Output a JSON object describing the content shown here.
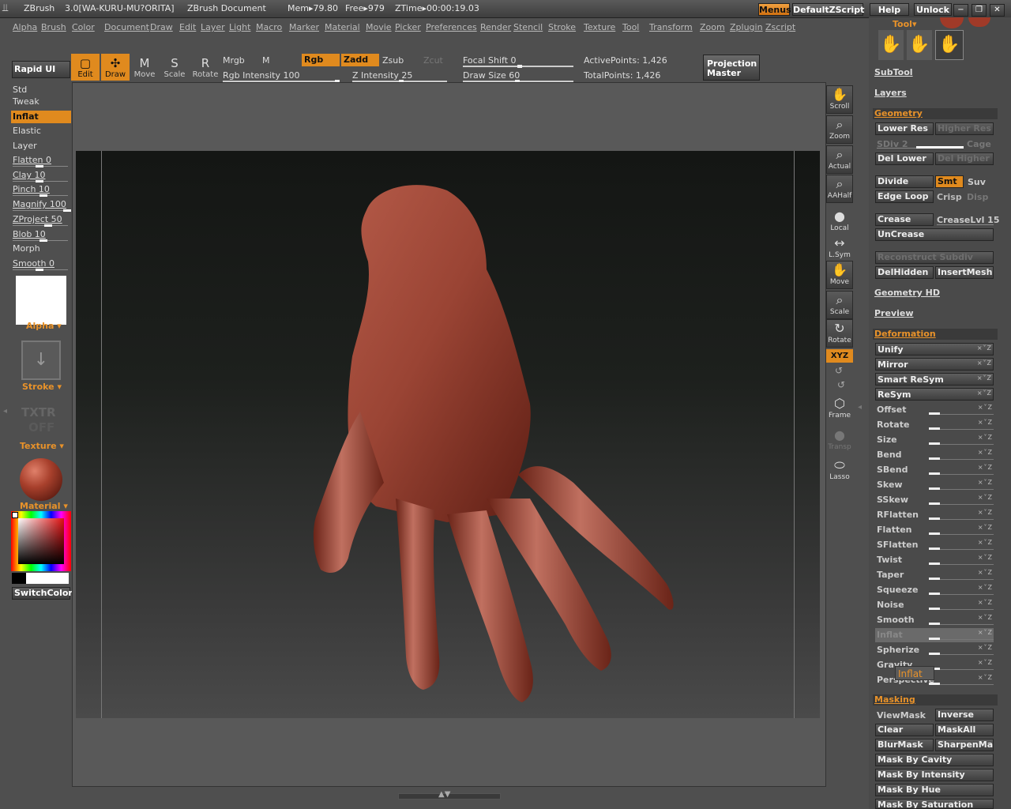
{
  "title": {
    "app": "ZBrush",
    "version": "3.0[WA-KURU-MU?ORITA]",
    "document": "ZBrush Document",
    "mem": "Mem▸79.80",
    "free": "Free▸979",
    "ztime": "ZTime▸00:00:19.03",
    "menus_btn": "Menus",
    "script_btn": "DefaultZScript",
    "help_btn": "Help",
    "unlock_btn": "Unlock"
  },
  "menubar": [
    "Alpha",
    "Brush",
    "Color",
    "Document",
    "Draw",
    "Edit",
    "Layer",
    "Light",
    "Macro",
    "Marker",
    "Material",
    "Movie",
    "Picker",
    "Preferences",
    "Render",
    "Stencil",
    "Stroke",
    "Texture",
    "Tool",
    "Transform",
    "Zoom",
    "Zplugin",
    "Zscript"
  ],
  "toolbar": {
    "rapid_ui": "Rapid UI",
    "edit": "Edit",
    "draw": "Draw",
    "move": "Move",
    "scale": "Scale",
    "rotate": "Rotate",
    "mrgb": "Mrgb",
    "m": "M",
    "rgb": "Rgb",
    "zadd": "Zadd",
    "zsub": "Zsub",
    "zcut": "Zcut",
    "rgb_intensity": "Rgb Intensity 100",
    "z_intensity": "Z Intensity 25",
    "focal_shift": "Focal Shift 0",
    "draw_size": "Draw Size 60",
    "active_points": "ActivePoints: 1,426",
    "total_points": "TotalPoints: 1,426",
    "projection_master": "Projection Master"
  },
  "left_panel": {
    "brushes": [
      "Std",
      "Tweak",
      "Inflat",
      "Elastic",
      "Layer"
    ],
    "selected": "Inflat",
    "sliders": [
      {
        "label": "Flatten 0",
        "value": 0
      },
      {
        "label": "Clay 10",
        "value": 10
      },
      {
        "label": "Pinch 10",
        "value": 10
      },
      {
        "label": "Magnify 100",
        "value": 100
      },
      {
        "label": "ZProject 50",
        "value": 50
      },
      {
        "label": "Blob 10",
        "value": 10
      }
    ],
    "morph": "Morph",
    "smooth": "Smooth 0",
    "alpha": "Alpha",
    "stroke": "Stroke",
    "txtr": "TXTR",
    "off": "OFF",
    "texture": "Texture",
    "material": "Material",
    "switch_color": "SwitchColor"
  },
  "right_toolbar": {
    "scroll": "Scroll",
    "zoom": "Zoom",
    "actual": "Actual",
    "aahalf": "AAHalf",
    "local": "Local",
    "lsym": "L.Sym",
    "move": "Move",
    "scale": "Scale",
    "rotate": "Rotate",
    "xyz": "XYZ",
    "frame": "Frame",
    "transp": "Transp",
    "lasso": "Lasso"
  },
  "right_panel": {
    "tool": "Tool",
    "subtool": "SubTool",
    "layers": "Layers",
    "geometry": "Geometry",
    "lower_res": "Lower Res",
    "higher_res": "Higher Res",
    "sdiv": "SDiv 2",
    "cage": "Cage",
    "del_lower": "Del Lower",
    "del_higher": "Del Higher",
    "divide": "Divide",
    "smt": "Smt",
    "suv": "Suv",
    "edge_loop": "Edge Loop",
    "crisp": "Crisp",
    "disp": "Disp",
    "crease": "Crease",
    "crease_lvl": "CreaseLvl 15",
    "uncrease": "UnCrease",
    "reconstruct": "Reconstruct Subdiv",
    "del_hidden": "DelHidden",
    "insert_mesh": "InsertMesh",
    "geometry_hd": "Geometry HD",
    "preview": "Preview",
    "deformation": "Deformation",
    "def_buttons": [
      "Unify",
      "Mirror",
      "Smart ReSym",
      "ReSym"
    ],
    "def_sliders": [
      "Offset",
      "Rotate",
      "Size",
      "Bend",
      "SBend",
      "Skew",
      "SSkew",
      "RFlatten",
      "Flatten",
      "SFlatten",
      "Twist",
      "Taper",
      "Squeeze",
      "Noise",
      "Smooth",
      "Inflat",
      "Spherize",
      "Gravity",
      "Perspective"
    ],
    "tooltip": "Inflat",
    "masking": "Masking",
    "view_mask": "ViewMask",
    "inverse": "Inverse",
    "clear": "Clear",
    "mask_all": "MaskAll",
    "blur_mask": "BlurMask",
    "sharpen_mask": "SharpenMask",
    "mask_by_cavity": "Mask By Cavity",
    "mask_by_intensity": "Mask By Intensity",
    "mask_by_hue": "Mask By Hue",
    "mask_by_saturation": "Mask By Saturation"
  },
  "colors": {
    "accent": "#e08a1e",
    "panel": "#4a4a4a",
    "model": "#8a3a2c"
  }
}
